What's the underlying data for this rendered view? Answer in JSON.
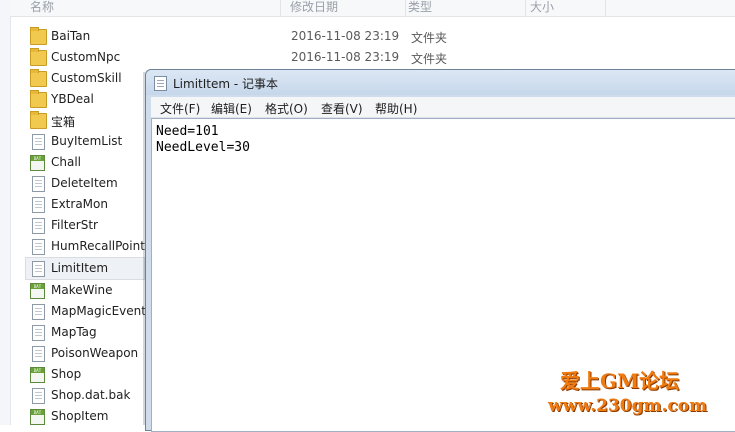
{
  "explorer": {
    "columns": [
      "名称",
      "修改日期",
      "类型",
      "大小"
    ],
    "rows": [
      {
        "name": "BaiTan",
        "icon": "folder-icon",
        "date": "2016-11-08 23:19",
        "type": "文件夹"
      },
      {
        "name": "CustomNpc",
        "icon": "folder-icon",
        "date": "2016-11-08 23:19",
        "type": "文件夹"
      },
      {
        "name": "CustomSkill",
        "icon": "folder-icon",
        "date": "",
        "type": ""
      },
      {
        "name": "YBDeal",
        "icon": "folder-icon",
        "date": "",
        "type": ""
      },
      {
        "name": "宝箱",
        "icon": "folder-icon",
        "date": "",
        "type": ""
      },
      {
        "name": "BuyItemList",
        "icon": "text-file-icon",
        "date": "",
        "type": ""
      },
      {
        "name": "Chall",
        "icon": "dat-file-icon",
        "date": "",
        "type": ""
      },
      {
        "name": "DeleteItem",
        "icon": "text-file-icon",
        "date": "",
        "type": ""
      },
      {
        "name": "ExtraMon",
        "icon": "text-file-icon",
        "date": "",
        "type": ""
      },
      {
        "name": "FilterStr",
        "icon": "text-file-icon",
        "date": "",
        "type": ""
      },
      {
        "name": "HumRecallPoint",
        "icon": "text-file-icon",
        "date": "",
        "type": ""
      },
      {
        "name": "LimitItem",
        "icon": "text-file-icon",
        "date": "",
        "type": "",
        "selected": true
      },
      {
        "name": "MakeWine",
        "icon": "dat-file-icon",
        "date": "",
        "type": ""
      },
      {
        "name": "MapMagicEvent",
        "icon": "text-file-icon",
        "date": "",
        "type": ""
      },
      {
        "name": "MapTag",
        "icon": "text-file-icon",
        "date": "",
        "type": ""
      },
      {
        "name": "PoisonWeapon",
        "icon": "text-file-icon",
        "date": "",
        "type": ""
      },
      {
        "name": "Shop",
        "icon": "dat-file-icon",
        "date": "",
        "type": ""
      },
      {
        "name": "Shop.dat.bak",
        "icon": "text-file-icon",
        "date": "",
        "type": ""
      },
      {
        "name": "ShopItem",
        "icon": "dat-file-icon",
        "date": "",
        "type": ""
      }
    ]
  },
  "notepad": {
    "title": "LimitItem - 记事本",
    "menu": [
      "文件(F)",
      "编辑(E)",
      "格式(O)",
      "查看(V)",
      "帮助(H)"
    ],
    "lines": [
      "Need=101",
      "NeedLevel=30"
    ]
  },
  "watermark": {
    "title": "爱上GM论坛",
    "url": "www.230gm.com"
  },
  "colors": {
    "watermark": "#f07b10",
    "notepad_frame": "#cfdcec"
  }
}
